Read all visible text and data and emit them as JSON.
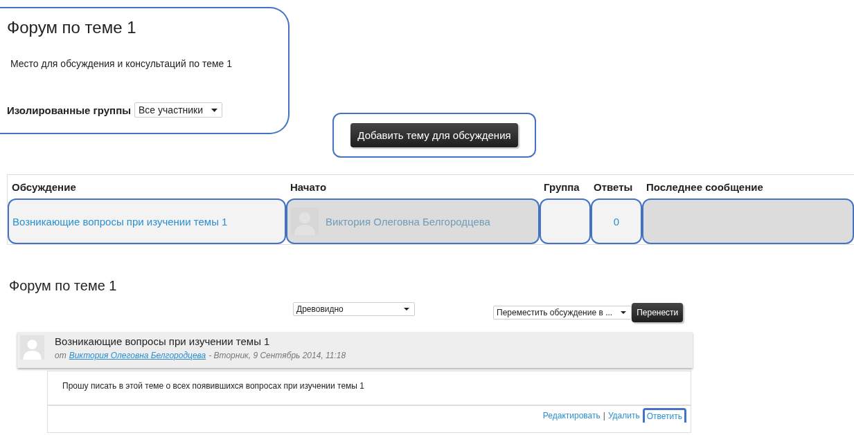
{
  "forum": {
    "title": "Форум по теме 1",
    "description": "Место для обсуждения и консультаций по теме 1",
    "group_mode": {
      "label": "Изолированные группы",
      "value": "Все участники"
    }
  },
  "add_button": "Добавить тему для обсуждения",
  "table": {
    "columns": [
      "Обсуждение",
      "Начато",
      "Группа",
      "Ответы",
      "Последнее сообщение"
    ],
    "rows": [
      {
        "discussion": "Возникающие вопросы при изучении темы 1",
        "started_by": "Виктория Олеговна Белгородцева",
        "replies": "0"
      }
    ]
  },
  "discussion": {
    "title": "Форум по теме 1",
    "display_mode": "Древовидно",
    "move": {
      "value": "Переместить обсуждение в ...",
      "button": "Перенести"
    },
    "post": {
      "subject": "Возникающие вопросы при изучении темы 1",
      "by_prefix": "от",
      "author": "Виктория Олеговна Белгородцева",
      "date": "- Вторник, 9 Сентябрь 2014, 11:18",
      "message": "Прошу писать в этой теме о всех появившихся вопросах при изучении темы 1",
      "actions": [
        {
          "kind": "link",
          "text": "Редактировать",
          "highlighted": false
        },
        {
          "kind": "separator",
          "text": "|",
          "highlighted": false
        },
        {
          "kind": "link",
          "text": "Удалить",
          "highlighted": false
        },
        {
          "kind": "link",
          "text": "Ответить",
          "highlighted": true
        }
      ]
    }
  }
}
